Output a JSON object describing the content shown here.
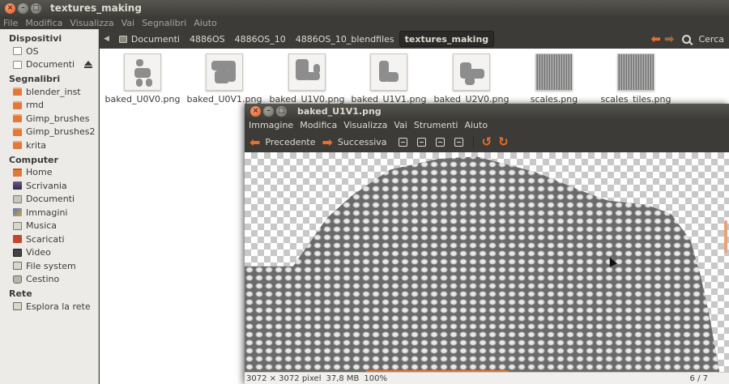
{
  "fm": {
    "title": "textures_making",
    "menu": [
      "File",
      "Modifica",
      "Visualizza",
      "Vai",
      "Segnalibri",
      "Aiuto"
    ],
    "path": [
      "Documenti",
      "4886OS",
      "4886OS_10",
      "4886OS_10_blendfiles",
      "textures_making"
    ],
    "search_label": "Cerca"
  },
  "sidebar": {
    "sections": [
      {
        "title": "Dispositivi",
        "items": [
          {
            "label": "OS",
            "icon": "drive-icon"
          },
          {
            "label": "Documenti",
            "icon": "drive-icon",
            "eject": true
          }
        ]
      },
      {
        "title": "Segnalibri",
        "items": [
          {
            "label": "blender_inst",
            "icon": "folder-icon"
          },
          {
            "label": "rmd",
            "icon": "folder-icon"
          },
          {
            "label": "Gimp_brushes",
            "icon": "folder-icon"
          },
          {
            "label": "Gimp_brushes2",
            "icon": "folder-icon"
          },
          {
            "label": "krita",
            "icon": "folder-icon"
          }
        ]
      },
      {
        "title": "Computer",
        "items": [
          {
            "label": "Home",
            "icon": "home-icon"
          },
          {
            "label": "Scrivania",
            "icon": "desktop-icon"
          },
          {
            "label": "Documenti",
            "icon": "documents-icon"
          },
          {
            "label": "Immagini",
            "icon": "pictures-icon"
          },
          {
            "label": "Musica",
            "icon": "music-icon"
          },
          {
            "label": "Scaricati",
            "icon": "downloads-icon"
          },
          {
            "label": "Video",
            "icon": "videos-icon"
          },
          {
            "label": "File system",
            "icon": "filesystem-icon"
          },
          {
            "label": "Cestino",
            "icon": "trash-icon"
          }
        ]
      },
      {
        "title": "Rete",
        "items": [
          {
            "label": "Esplora la rete",
            "icon": "network-icon"
          }
        ]
      }
    ]
  },
  "files": [
    {
      "name": "baked_U0V0.png",
      "kind": "uv"
    },
    {
      "name": "baked_U0V1.png",
      "kind": "uv"
    },
    {
      "name": "baked_U1V0.png",
      "kind": "uv"
    },
    {
      "name": "baked_U1V1.png",
      "kind": "uv"
    },
    {
      "name": "baked_U2V0.png",
      "kind": "uv"
    },
    {
      "name": "scales.png",
      "kind": "texture"
    },
    {
      "name": "scales_tiles.png",
      "kind": "texture"
    }
  ],
  "viewer": {
    "title": "baked_U1V1.png",
    "menu": [
      "Immagine",
      "Modifica",
      "Visualizza",
      "Vai",
      "Strumenti",
      "Aiuto"
    ],
    "prev_label": "Precedente",
    "next_label": "Successiva",
    "status": {
      "dimensions": "3072 × 3072 pixel",
      "size": "37,8 MB",
      "zoom": "100%",
      "counter": "6 / 7"
    }
  },
  "colors": {
    "accent": "#e8702a",
    "titlebar": "#3c3b37",
    "sidebar_bg": "#edebe8"
  }
}
